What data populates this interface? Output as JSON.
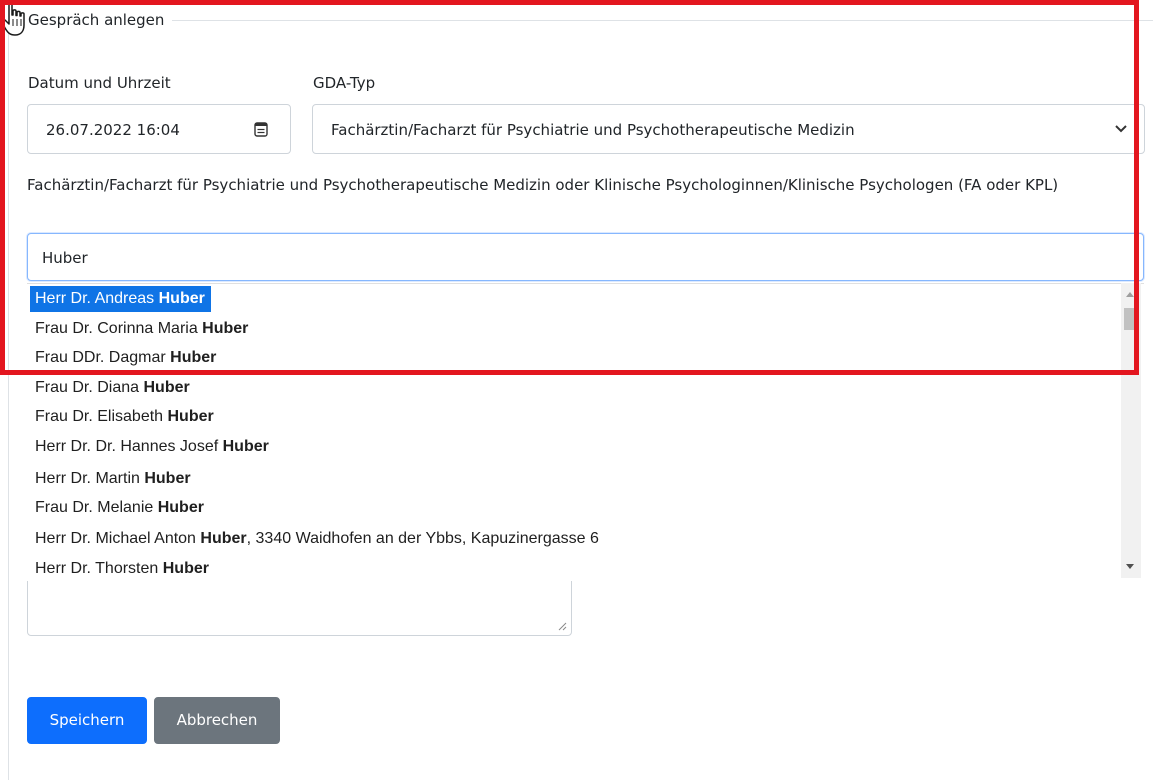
{
  "form": {
    "legend": "Gespräch anlegen",
    "datetime_label": "Datum und Uhrzeit",
    "datetime_value": "26.07.2022 16:04",
    "gda_type_label": "GDA-Typ",
    "gda_type_value": "Fachärztin/Facharzt für Psychiatrie und Psychotherapeutische Medizin",
    "specialist_label": "Fachärztin/Facharzt für Psychiatrie und Psychotherapeutische Medizin oder Klinische Psychologinnen/Klinische Psychologen (FA oder KPL)",
    "search_value": "Huber"
  },
  "results": [
    {
      "prefix": "Herr Dr. Andreas ",
      "match": "Huber",
      "suffix": ""
    },
    {
      "prefix": "Frau Dr. Corinna Maria ",
      "match": "Huber",
      "suffix": ""
    },
    {
      "prefix": "Frau DDr. Dagmar ",
      "match": "Huber",
      "suffix": ""
    },
    {
      "prefix": "Frau Dr. Diana ",
      "match": "Huber",
      "suffix": ""
    },
    {
      "prefix": "Frau Dr. Elisabeth ",
      "match": "Huber",
      "suffix": ""
    },
    {
      "prefix": "Herr Dr. Dr. Hannes Josef ",
      "match": "Huber",
      "suffix": ""
    },
    {
      "prefix": "Herr Dr. Martin ",
      "match": "Huber",
      "suffix": ""
    },
    {
      "prefix": "Frau Dr. Melanie ",
      "match": "Huber",
      "suffix": ""
    },
    {
      "prefix": "Herr Dr. Michael Anton ",
      "match": "Huber",
      "suffix": ", 3340 Waidhofen an der Ybbs, Kapuzinergasse 6"
    },
    {
      "prefix": "Herr Dr. Thorsten ",
      "match": "Huber",
      "suffix": ""
    }
  ],
  "selected_index": 0,
  "buttons": {
    "save": "Speichern",
    "cancel": "Abbrechen"
  },
  "colors": {
    "highlight_frame": "#e3161f",
    "primary": "#0d6efd",
    "secondary": "#6c757d",
    "selection": "#0f74e6"
  },
  "icons": {
    "calendar": "calendar-icon",
    "select_arrow": "chevron-down-icon",
    "cursor": "hand-cursor-icon",
    "resize": "resize-grip-icon"
  }
}
